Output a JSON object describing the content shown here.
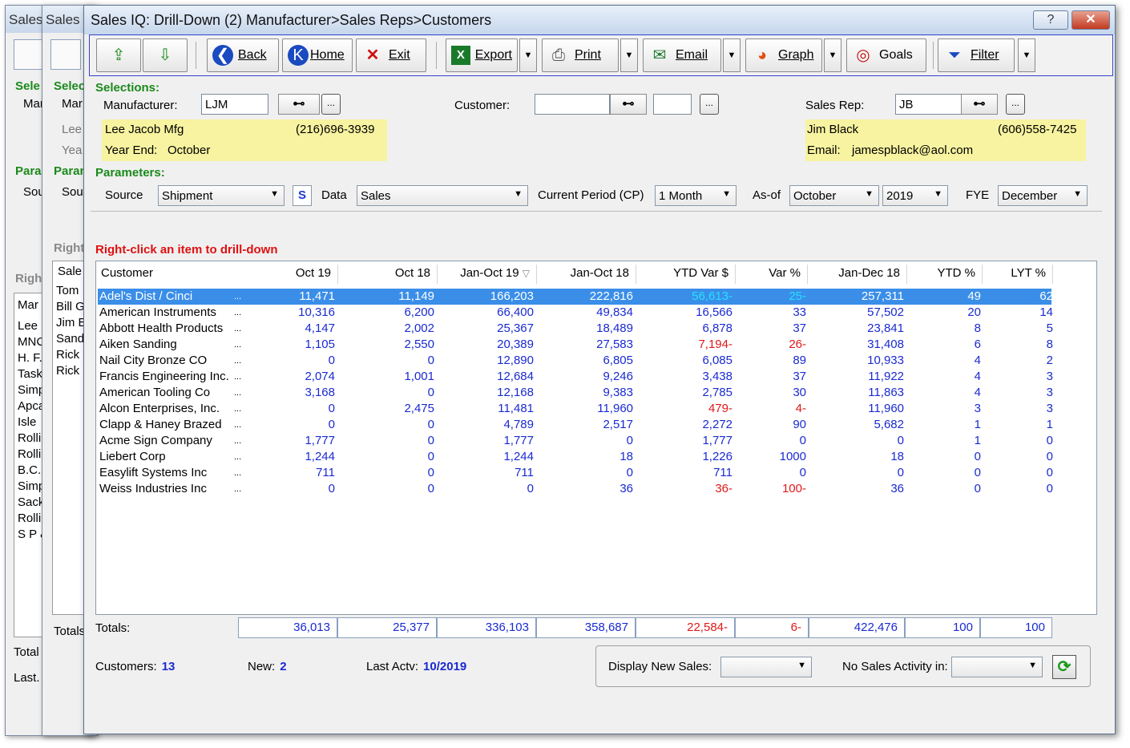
{
  "background": {
    "win1": {
      "title": "Sales",
      "sel": "Sele",
      "man": "Mar",
      "para": "Para",
      "sou": "Sou",
      "right": "Right",
      "list_head": "Mar",
      "list": [
        "Lee",
        "MNC",
        "H. F.",
        "Task",
        "Simp",
        "Apca",
        "Isle",
        "Rolli",
        "Rolli",
        "B.C.",
        "Simp",
        "Sack",
        "Rolli",
        "S P &"
      ],
      "total": "Total",
      "last": "Last."
    },
    "win2": {
      "title": "Sales",
      "sel": "Selec",
      "man": "Mar",
      "lee": "Lee",
      "yea": "Yea",
      "para": "Param",
      "sou": "Sou",
      "right": "Right",
      "list_head": "Sale",
      "list": [
        "Tom",
        "Bill G",
        "Jim E",
        "Sand",
        "Rick",
        "Rick"
      ],
      "totals": "Totals"
    }
  },
  "window": {
    "title": "Sales IQ: Drill-Down (2) Manufacturer>Sales Reps>Customers",
    "help": "?",
    "close": "✕"
  },
  "toolbar": {
    "back": "Back",
    "home": "Home",
    "exit": "Exit",
    "export": "Export",
    "print": "Print",
    "email": "Email",
    "graph": "Graph",
    "goals": "Goals",
    "filter": "Filter"
  },
  "selections": {
    "heading": "Selections:",
    "manufacturer_label": "Manufacturer:",
    "manufacturer_value": "LJM",
    "customer_label": "Customer:",
    "customer_value": "",
    "salesrep_label": "Sales Rep:",
    "salesrep_value": "JB",
    "mfg_name": "Lee Jacob Mfg",
    "mfg_phone": "(216)696-3939",
    "year_end_label": "Year End:",
    "year_end_value": "October",
    "rep_name": "Jim Black",
    "rep_phone": "(606)558-7425",
    "email_label": "Email:",
    "email_value": "jamespblack@aol.com"
  },
  "parameters": {
    "heading": "Parameters:",
    "source_label": "Source",
    "source_value": "Shipment",
    "s_button": "S",
    "data_label": "Data",
    "data_value": "Sales",
    "cp_label": "Current Period (CP)",
    "cp_value": "1 Month",
    "asof_label": "As-of",
    "asof_month": "October",
    "asof_year": "2019",
    "fye_label": "FYE",
    "fye_value": "December"
  },
  "hint": "Right-click an item to drill-down",
  "columns": [
    "Customer",
    "Oct 19",
    "Oct 18",
    "Jan-Oct 19",
    "Jan-Oct 18",
    "YTD Var $",
    "Var %",
    "Jan-Dec 18",
    "YTD %",
    "LYT %"
  ],
  "rows": [
    {
      "name": "Adel's Dist / Cinci",
      "vals": [
        "11,471",
        "11,149",
        "166,203",
        "222,816",
        "56,613-",
        "25-",
        "257,311",
        "49",
        "62"
      ]
    },
    {
      "name": "American Instruments",
      "vals": [
        "10,316",
        "6,200",
        "66,400",
        "49,834",
        "16,566",
        "33",
        "57,502",
        "20",
        "14"
      ]
    },
    {
      "name": "Abbott Health Products",
      "vals": [
        "4,147",
        "2,002",
        "25,367",
        "18,489",
        "6,878",
        "37",
        "23,841",
        "8",
        "5"
      ]
    },
    {
      "name": "Aiken Sanding",
      "vals": [
        "1,105",
        "2,550",
        "20,389",
        "27,583",
        "7,194-",
        "26-",
        "31,408",
        "6",
        "8"
      ]
    },
    {
      "name": "Nail City Bronze CO",
      "vals": [
        "0",
        "0",
        "12,890",
        "6,805",
        "6,085",
        "89",
        "10,933",
        "4",
        "2"
      ]
    },
    {
      "name": "Francis Engineering Inc.",
      "vals": [
        "2,074",
        "1,001",
        "12,684",
        "9,246",
        "3,438",
        "37",
        "11,922",
        "4",
        "3"
      ]
    },
    {
      "name": "American Tooling Co",
      "vals": [
        "3,168",
        "0",
        "12,168",
        "9,383",
        "2,785",
        "30",
        "11,863",
        "4",
        "3"
      ]
    },
    {
      "name": "Alcon Enterprises, Inc.",
      "vals": [
        "0",
        "2,475",
        "11,481",
        "11,960",
        "479-",
        "4-",
        "11,960",
        "3",
        "3"
      ]
    },
    {
      "name": "Clapp & Haney Brazed",
      "vals": [
        "0",
        "0",
        "4,789",
        "2,517",
        "2,272",
        "90",
        "5,682",
        "1",
        "1"
      ]
    },
    {
      "name": "Acme Sign Company",
      "vals": [
        "1,777",
        "0",
        "1,777",
        "0",
        "1,777",
        "0",
        "0",
        "1",
        "0"
      ]
    },
    {
      "name": "Liebert Corp",
      "vals": [
        "1,244",
        "0",
        "1,244",
        "18",
        "1,226",
        "1000",
        "18",
        "0",
        "0"
      ]
    },
    {
      "name": "Easylift Systems Inc",
      "vals": [
        "711",
        "0",
        "711",
        "0",
        "711",
        "0",
        "0",
        "0",
        "0"
      ]
    },
    {
      "name": "Weiss Industries Inc",
      "vals": [
        "0",
        "0",
        "0",
        "36",
        "36-",
        "100-",
        "36",
        "0",
        "0"
      ]
    }
  ],
  "row_dots": "...",
  "totals": {
    "label": "Totals:",
    "vals": [
      "36,013",
      "25,377",
      "336,103",
      "358,687",
      "22,584-",
      "6-",
      "422,476",
      "100",
      "100"
    ]
  },
  "footer": {
    "customers_label": "Customers:",
    "customers_value": "13",
    "new_label": "New:",
    "new_value": "2",
    "lastactv_label": "Last Actv:",
    "lastactv_value": "10/2019",
    "display_new_label": "Display New Sales:",
    "display_new_value": "",
    "nosales_label": "No Sales Activity in:",
    "nosales_value": ""
  },
  "colors": {
    "accent": "#1a2ad0",
    "negative": "#e01818",
    "header_green": "#1a8a1a",
    "selected_row": "#3a8ee8",
    "highlight_yellow": "#f7f3a0"
  }
}
